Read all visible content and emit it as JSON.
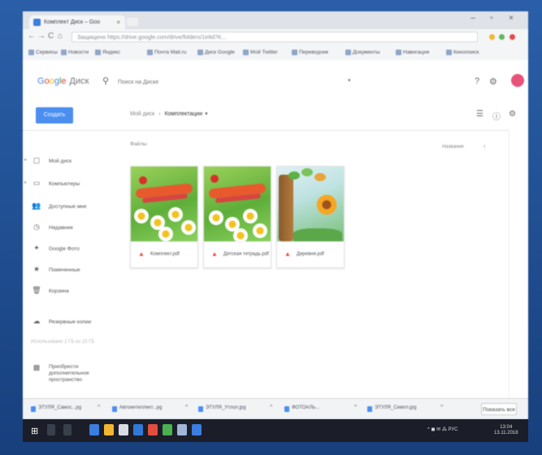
{
  "browser": {
    "tab_title": "Комплект Диск – Goo",
    "tab_close": "×",
    "window_minimize": "–",
    "window_maximize": "▫",
    "window_close": "×",
    "back": "←",
    "forward": "→",
    "reload": "C",
    "home": "⌂",
    "address": "Защищено  https://drive.google.com/drive/folders/1e6d7K...",
    "bookmarks": [
      "Сервисы",
      "Новости",
      "Яндекс",
      "Почта Mail.ru",
      "Диск Google",
      "Мой Twitter",
      "Переводчик",
      "Документы",
      "Навигация",
      "Кинопоиск"
    ]
  },
  "drive": {
    "logo_letters": [
      "G",
      "o",
      "o",
      "g",
      "l",
      "e"
    ],
    "product_name": "Диск",
    "search_placeholder": "Поиск на Диске",
    "search_dropdown": "▾",
    "help_icon": "?",
    "settings_icon": "⚙",
    "apps_icon": "⋮⋮⋮"
  },
  "toolbar": {
    "create_label": "Создать",
    "breadcrumb_root": "Мой диск",
    "breadcrumb_separator": "›",
    "breadcrumb_current": "Комплектации",
    "breadcrumb_dropdown": "▾",
    "list_view_icon": "☰",
    "info_icon": "ⓘ",
    "settings_icon": "⚙"
  },
  "sidebar": {
    "items": [
      {
        "label": "Мой диск",
        "icon": "▢",
        "expandable": true
      },
      {
        "label": "Компьютеры",
        "icon": "▭",
        "expandable": true
      },
      {
        "label": "Доступные мне",
        "icon": "👥",
        "expandable": false
      },
      {
        "label": "Недавние",
        "icon": "◷",
        "expandable": false
      },
      {
        "label": "Google Фото",
        "icon": "✦",
        "expandable": false
      },
      {
        "label": "Помеченные",
        "icon": "★",
        "expandable": false
      },
      {
        "label": "Корзина",
        "icon": "🗑",
        "expandable": false
      },
      {
        "label": "Резервные копии",
        "icon": "☁",
        "expandable": false
      },
      {
        "label": "Приобрести дополнительное пространство",
        "icon": "▦",
        "expandable": false
      }
    ],
    "storage_text": "Использовано 2 ГБ из 15 ГБ"
  },
  "content": {
    "files_label": "Файлы",
    "sort_label": "Название",
    "sort_arrow": "↑",
    "files": [
      {
        "name": "Комплект.pdf",
        "thumb": "daisy-green"
      },
      {
        "name": "Детская тетрадь.pdf",
        "thumb": "daisy-green"
      },
      {
        "name": "Деревня.pdf",
        "thumb": "forest-sunflower"
      }
    ]
  },
  "downloads": {
    "items": [
      "ЭТУЛЯ_Самос...pg",
      "Автоинтеллект...pg",
      "ЭТУЛЯ_Утлол.jpg",
      "ФОТОАЛЬ...",
      "ЭТУЛЯ_Симпл.jpg"
    ],
    "chevron": "^",
    "show_all": "Показать все"
  },
  "taskbar": {
    "start_icon": "⊞",
    "tray_text": "^  ◼ ✉ ⁂ РУС",
    "time": "13:04",
    "date": "13.11.2018"
  },
  "colors": {
    "accent": "#4a8ef0",
    "avatar": "#e8527a",
    "file_icon": "#e84c3d"
  }
}
